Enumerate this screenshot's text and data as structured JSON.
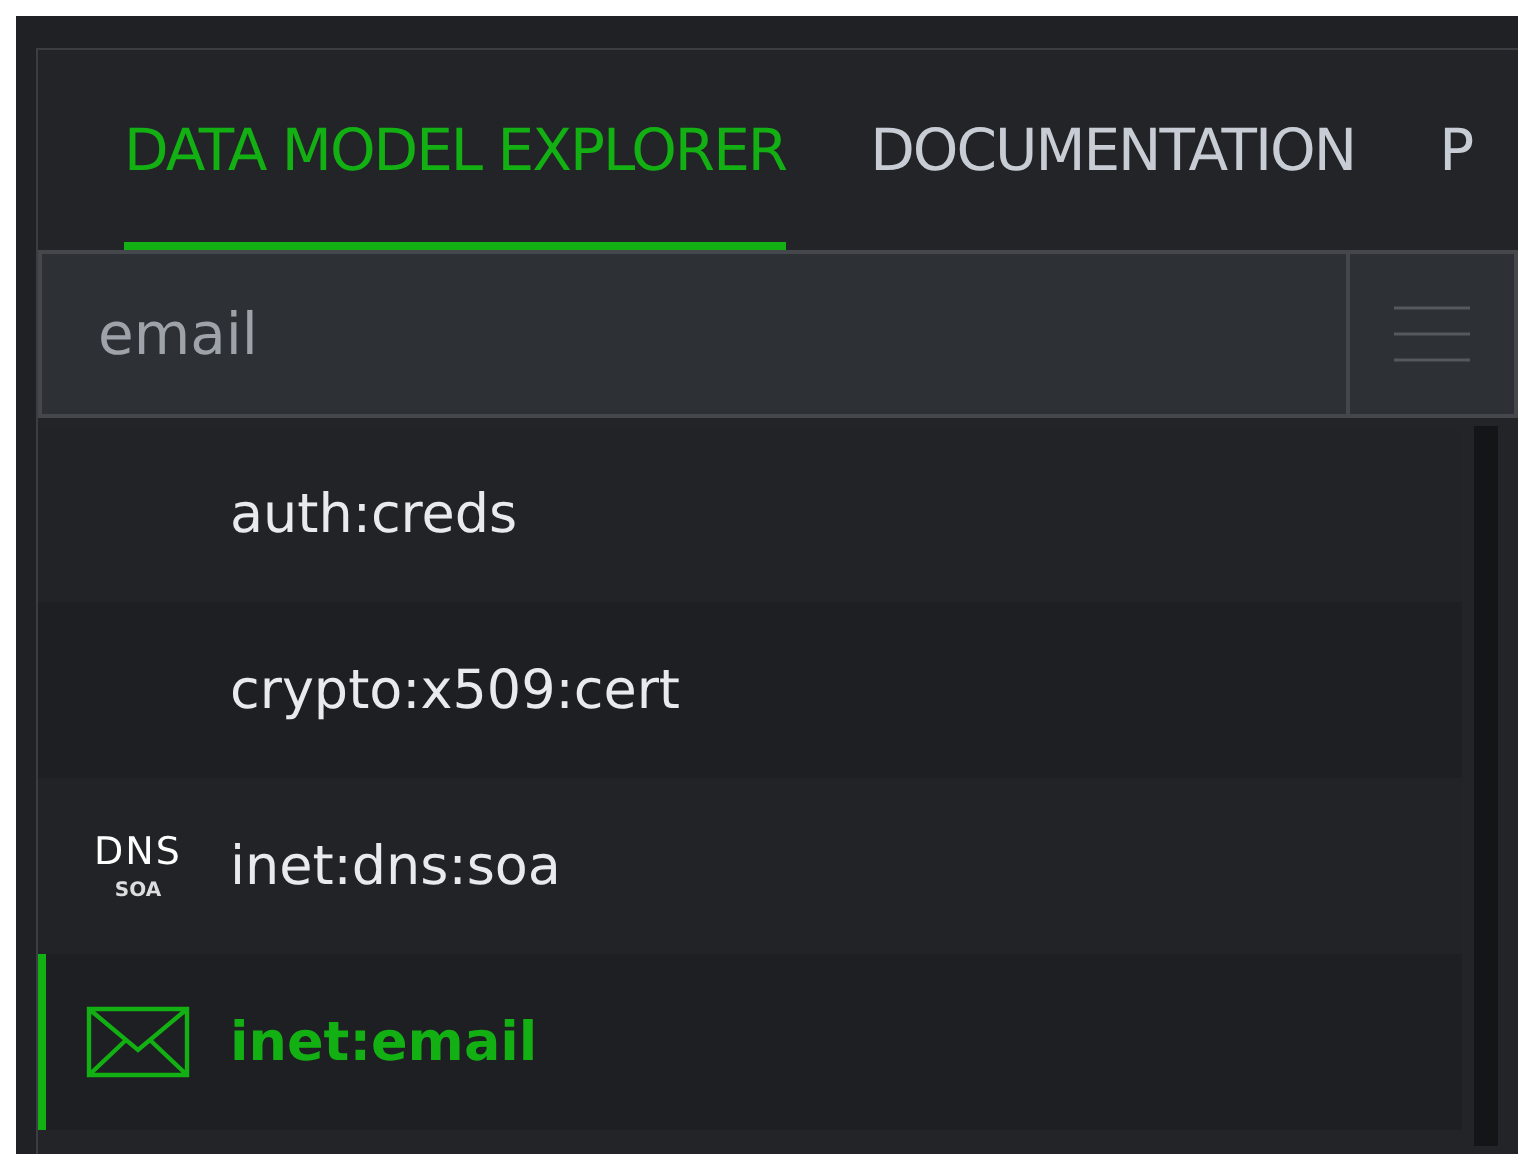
{
  "tabs": [
    {
      "label": "DATA MODEL EXPLORER",
      "selected": true
    },
    {
      "label": "DOCUMENTATION",
      "selected": false
    },
    {
      "label": "P",
      "selected": false
    }
  ],
  "search": {
    "value": "email"
  },
  "items": [
    {
      "label": "auth:creds",
      "kind": "plain",
      "selected": false
    },
    {
      "label": "crypto:x509:cert",
      "kind": "plain",
      "selected": false
    },
    {
      "label": "inet:dns:soa",
      "kind": "dns",
      "icon_text": "DNS",
      "icon_subtext": "SOA",
      "selected": false
    },
    {
      "label": "inet:email",
      "kind": "email",
      "selected": true
    }
  ]
}
